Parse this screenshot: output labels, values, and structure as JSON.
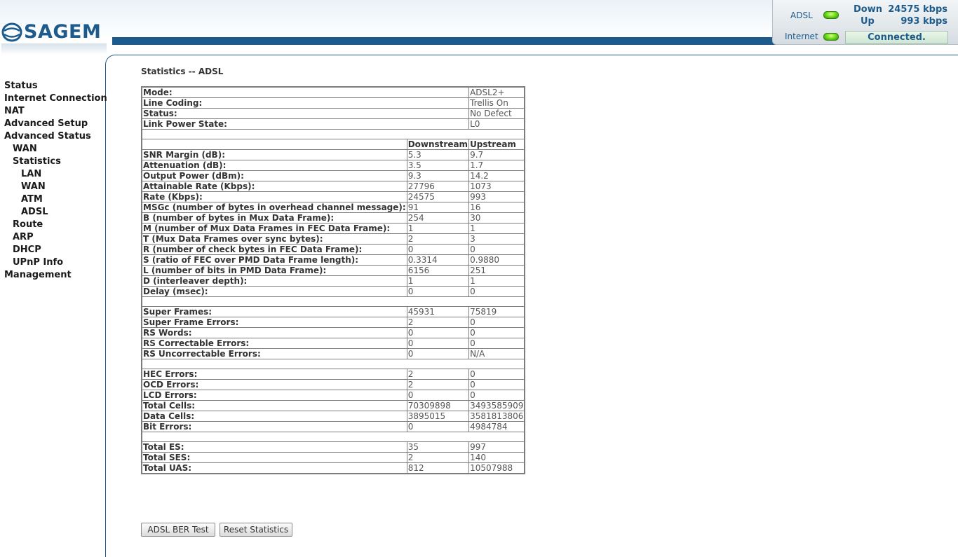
{
  "header": {
    "logo_text": "SAGEM"
  },
  "status_panel": {
    "adsl_label": "ADSL",
    "internet_label": "Internet",
    "down_label": "Down",
    "down_value": "24575 kbps",
    "up_label": "Up",
    "up_value": "993 kbps",
    "connection_status": "Connected.",
    "led_color": "#5fd414"
  },
  "sidebar": {
    "items": [
      {
        "label": "Status",
        "level": 0
      },
      {
        "label": "Internet Connection",
        "level": 0
      },
      {
        "label": "NAT",
        "level": 0
      },
      {
        "label": "Advanced Setup",
        "level": 0
      },
      {
        "label": "Advanced Status",
        "level": 0
      },
      {
        "label": "WAN",
        "level": 1
      },
      {
        "label": "Statistics",
        "level": 1
      },
      {
        "label": "LAN",
        "level": 2
      },
      {
        "label": "WAN",
        "level": 2
      },
      {
        "label": "ATM",
        "level": 2
      },
      {
        "label": "ADSL",
        "level": 2
      },
      {
        "label": "Route",
        "level": 1
      },
      {
        "label": "ARP",
        "level": 1
      },
      {
        "label": "DHCP",
        "level": 1
      },
      {
        "label": "UPnP Info",
        "level": 1
      },
      {
        "label": "Management",
        "level": 0
      }
    ]
  },
  "page": {
    "title": "Statistics -- ADSL"
  },
  "stats": {
    "header_downstream": "Downstream",
    "header_upstream": "Upstream",
    "info_rows": [
      {
        "label": "Mode:",
        "value": "ADSL2+"
      },
      {
        "label": "Line Coding:",
        "value": "Trellis On"
      },
      {
        "label": "Status:",
        "value": "No Defect"
      },
      {
        "label": "Link Power State:",
        "value": "L0"
      }
    ],
    "groups": [
      [
        {
          "label": "SNR Margin (dB):",
          "down": "5.3",
          "up": "9.7"
        },
        {
          "label": "Attenuation (dB):",
          "down": "3.5",
          "up": "1.7"
        },
        {
          "label": "Output Power (dBm):",
          "down": "9.3",
          "up": "14.2"
        },
        {
          "label": "Attainable Rate (Kbps):",
          "down": "27796",
          "up": "1073"
        },
        {
          "label": "Rate (Kbps):",
          "down": "24575",
          "up": "993"
        },
        {
          "label": "MSGc (number of bytes in overhead channel message):",
          "down": "91",
          "up": "16"
        },
        {
          "label": "B (number of bytes in Mux Data Frame):",
          "down": "254",
          "up": "30"
        },
        {
          "label": "M (number of Mux Data Frames in FEC Data Frame):",
          "down": "1",
          "up": "1"
        },
        {
          "label": "T (Mux Data Frames over sync bytes):",
          "down": "2",
          "up": "3"
        },
        {
          "label": "R (number of check bytes in FEC Data Frame):",
          "down": "0",
          "up": "0"
        },
        {
          "label": "S (ratio of FEC over PMD Data Frame length):",
          "down": "0.3314",
          "up": "0.9880"
        },
        {
          "label": "L (number of bits in PMD Data Frame):",
          "down": "6156",
          "up": "251"
        },
        {
          "label": "D (interleaver depth):",
          "down": "1",
          "up": "1"
        },
        {
          "label": "Delay (msec):",
          "down": "0",
          "up": "0"
        }
      ],
      [
        {
          "label": "Super Frames:",
          "down": "45931",
          "up": "75819"
        },
        {
          "label": "Super Frame Errors:",
          "down": "2",
          "up": "0"
        },
        {
          "label": "RS Words:",
          "down": "0",
          "up": "0"
        },
        {
          "label": "RS Correctable Errors:",
          "down": "0",
          "up": "0"
        },
        {
          "label": "RS Uncorrectable Errors:",
          "down": "0",
          "up": "N/A"
        }
      ],
      [
        {
          "label": "HEC Errors:",
          "down": "2",
          "up": "0"
        },
        {
          "label": "OCD Errors:",
          "down": "2",
          "up": "0"
        },
        {
          "label": "LCD Errors:",
          "down": "0",
          "up": "0"
        },
        {
          "label": "Total Cells:",
          "down": "70309898",
          "up": "3493585909"
        },
        {
          "label": "Data Cells:",
          "down": "3895015",
          "up": "3581813806"
        },
        {
          "label": "Bit Errors:",
          "down": "0",
          "up": "4984784"
        }
      ],
      [
        {
          "label": "Total ES:",
          "down": "35",
          "up": "997"
        },
        {
          "label": "Total SES:",
          "down": "2",
          "up": "140"
        },
        {
          "label": "Total UAS:",
          "down": "812",
          "up": "10507988"
        }
      ]
    ]
  },
  "buttons": {
    "ber_test": "ADSL BER Test",
    "reset": "Reset Statistics"
  }
}
